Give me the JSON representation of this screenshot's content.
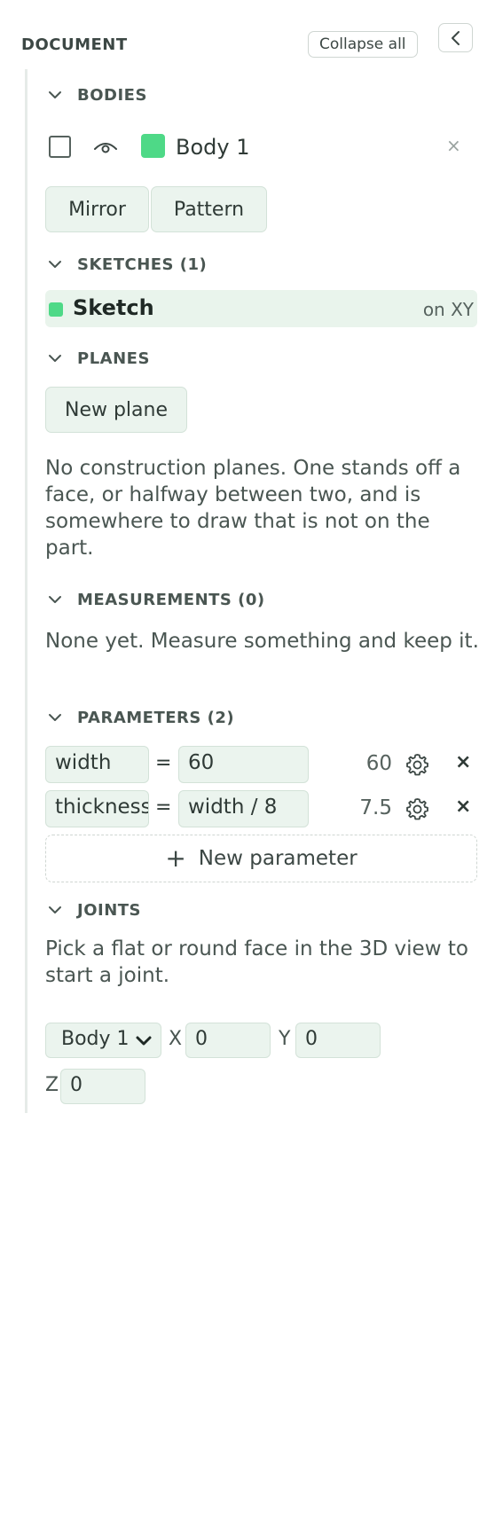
{
  "header": {
    "title": "DOCUMENT",
    "collapse_label": "Collapse all"
  },
  "bodies": {
    "heading": "BODIES",
    "items": [
      {
        "name": "Body 1",
        "color": "#4ed987",
        "remove": "×"
      }
    ],
    "actions": {
      "mirror": "Mirror",
      "pattern": "Pattern"
    }
  },
  "sketches": {
    "heading": "SKETCHES (1)",
    "items": [
      {
        "name": "Sketch",
        "plane": "on XY",
        "color": "#4ed987"
      }
    ]
  },
  "planes": {
    "heading": "PLANES",
    "new_label": "New plane",
    "empty_text": "No construction planes. One stands off a face, or halfway between two, and is somewhere to draw that is not on the part."
  },
  "measurements": {
    "heading": "MEASUREMENTS (0)",
    "empty_text": "None yet. Measure something and keep it."
  },
  "parameters": {
    "heading": "PARAMETERS (2)",
    "items": [
      {
        "name": "width",
        "eq": "=",
        "expr": "60",
        "value": "60",
        "remove": "×"
      },
      {
        "name": "thickness",
        "eq": "=",
        "expr": "width / 8",
        "value": "7.5",
        "remove": "×"
      }
    ],
    "new_label": "New parameter",
    "plus": "+"
  },
  "joints": {
    "heading": "JOINTS",
    "hint": "Pick a flat or round face in the 3D view to start a joint.",
    "body_select": "Body 1",
    "x_label": "X",
    "x_value": "0",
    "y_label": "Y",
    "y_value": "0",
    "z_label": "Z",
    "z_value": "0"
  }
}
